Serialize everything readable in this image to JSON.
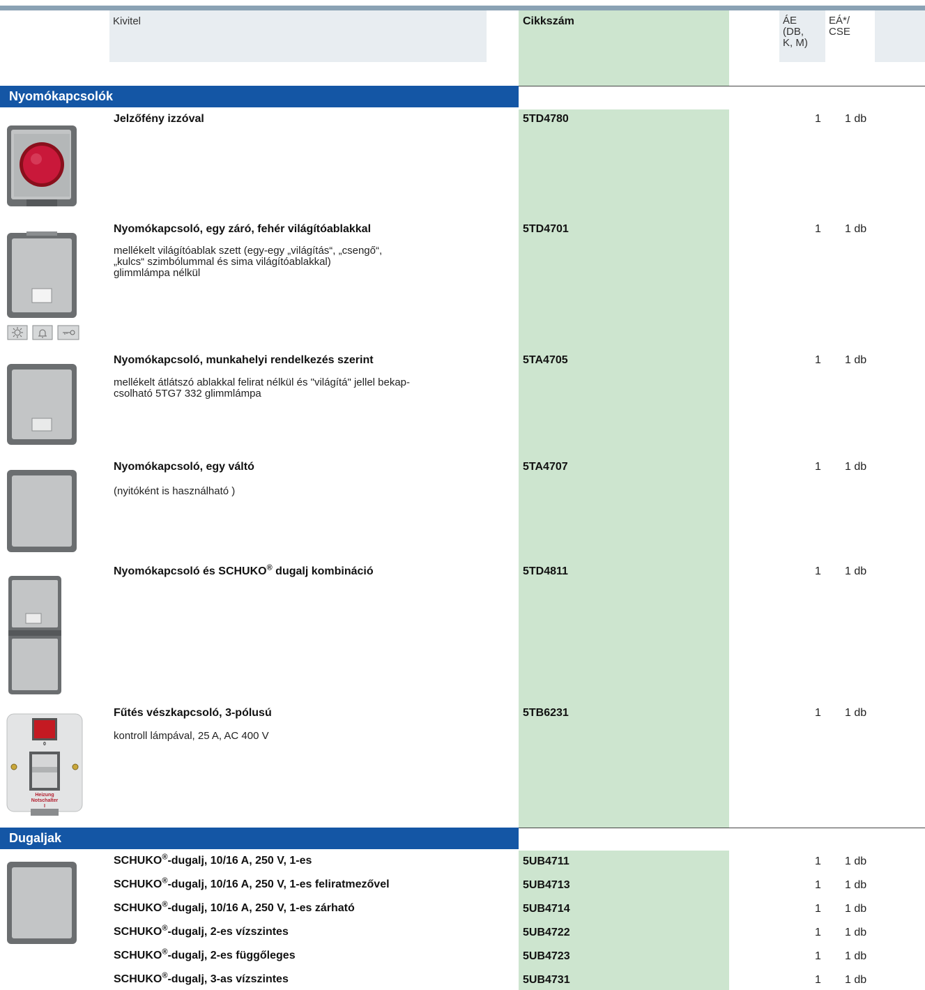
{
  "header": {
    "kivitel": "Kivitel",
    "cikkszam": "Cikkszám",
    "ae_lines": [
      "ÁE",
      "(DB,",
      "K, M)"
    ],
    "ea_lines": [
      "EÁ*/",
      "CSE"
    ]
  },
  "sections": [
    {
      "title": "Nyomókapcsolók"
    },
    {
      "title": "Dugaljak"
    }
  ],
  "products": [
    {
      "title": "Jelzőfény izzóval",
      "desc": [],
      "code": "5TD4780",
      "ae": "1",
      "ea": "1 db"
    },
    {
      "title": "Nyomókapcsoló, egy záró, fehér világítóablakkal",
      "desc": [
        "mellékelt világítóablak szett (egy-egy „világítás“, „csengő“,",
        "„kulcs“ szimbólummal és sima világítóablakkal)",
        "glimmlámpa nélkül"
      ],
      "code": "5TD4701",
      "ae": "1",
      "ea": "1 db"
    },
    {
      "title": "Nyomókapcsoló, munkahelyi rendelkezés szerint",
      "desc": [
        "mellékelt átlátszó ablakkal felirat nélkül és \"világítá\" jellel bekap-",
        "csolható 5TG7 332 glimmlámpa"
      ],
      "code": "5TA4705",
      "ae": "1",
      "ea": "1 db"
    },
    {
      "title": "Nyomókapcsoló, egy váltó",
      "desc": [
        "(nyitóként is használható )"
      ],
      "code": "5TA4707",
      "ae": "1",
      "ea": "1 db"
    },
    {
      "title_pre": "Nyomókapcsoló és SCHUKO",
      "title_sup": "®",
      "title_post": " dugalj kombináció",
      "desc": [],
      "code": "5TD4811",
      "ae": "1",
      "ea": "1 db"
    },
    {
      "title": "Fűtés vészkapcsoló, 3-pólusú",
      "desc": [
        "kontroll lámpával,  25 A, AC 400 V"
      ],
      "code": "5TB6231",
      "ae": "1",
      "ea": "1 db"
    }
  ],
  "socket_rows": [
    {
      "pre": "SCHUKO",
      "sup": "®",
      "post": "-dugalj, 10/16 A, 250 V, 1-es",
      "code": "5UB4711",
      "ae": "1",
      "ea": "1 db"
    },
    {
      "pre": "SCHUKO",
      "sup": "®",
      "post": "-dugalj, 10/16 A, 250 V, 1-es feliratmezővel",
      "code": "5UB4713",
      "ae": "1",
      "ea": "1 db"
    },
    {
      "pre": "SCHUKO",
      "sup": "®",
      "post": "-dugalj, 10/16 A, 250 V, 1-es zárható",
      "code": "5UB4714",
      "ae": "1",
      "ea": "1 db"
    },
    {
      "pre": "SCHUKO",
      "sup": "®",
      "post": "-dugalj, 2-es vízszintes",
      "code": "5UB4722",
      "ae": "1",
      "ea": "1 db"
    },
    {
      "pre": "SCHUKO",
      "sup": "®",
      "post": "-dugalj, 2-es függőleges",
      "code": "5UB4723",
      "ae": "1",
      "ea": "1 db"
    },
    {
      "pre": "SCHUKO",
      "sup": "®",
      "post": "-dugalj, 3-as vízszintes",
      "code": "5UB4731",
      "ae": "1",
      "ea": "1 db"
    }
  ],
  "device_labels": {
    "zero": "0",
    "line1": "Heizung",
    "line2": "Notschalter",
    "one": "I"
  },
  "colors": {
    "section_blue": "#1456a5",
    "code_green": "#cde5cf",
    "header_grey": "#e8edf1"
  }
}
